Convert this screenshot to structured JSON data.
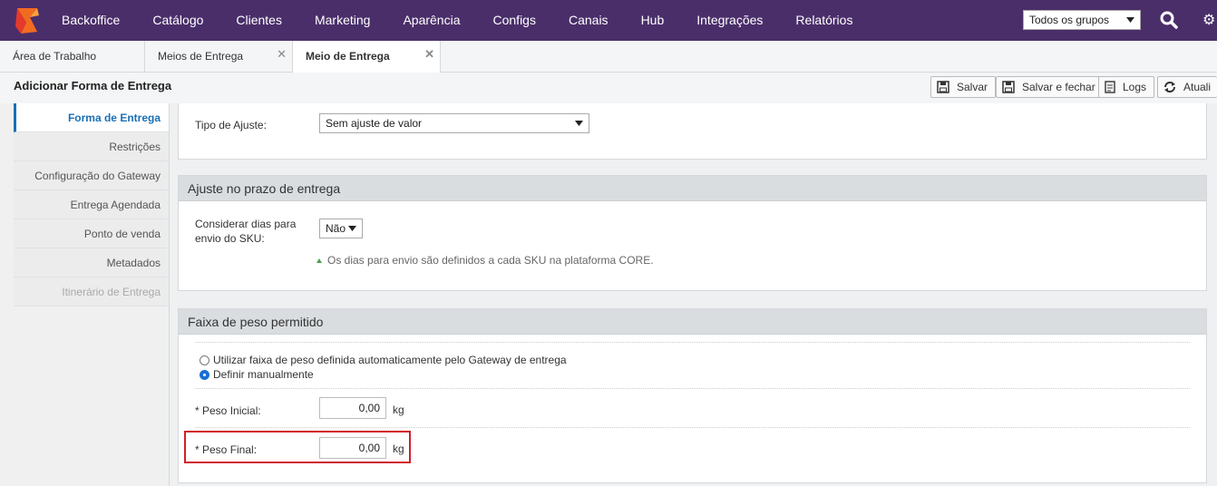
{
  "nav": {
    "items": [
      "Backoffice",
      "Catálogo",
      "Clientes",
      "Marketing",
      "Aparência",
      "Configs",
      "Canais",
      "Hub",
      "Integrações",
      "Relatórios"
    ],
    "group_select": "Todos os grupos"
  },
  "tabs": [
    {
      "label": "Área de Trabalho"
    },
    {
      "label": "Meios de Entrega",
      "close": "✕"
    },
    {
      "label": "Meio de Entrega",
      "close": "✕"
    }
  ],
  "title": "Adicionar Forma de Entrega",
  "toolbar": {
    "save": "Salvar",
    "save_close": "Salvar e fechar",
    "logs": "Logs",
    "refresh": "Atuali"
  },
  "left_menu": [
    "Forma de Entrega",
    "Restrições",
    "Configuração do Gateway",
    "Entrega Agendada",
    "Ponto de venda",
    "Metadados",
    "Itinerário de Entrega"
  ],
  "adjust": {
    "label": "Tipo de Ajuste:",
    "value": "Sem ajuste de valor"
  },
  "prazo": {
    "header": "Ajuste no prazo de entrega",
    "label_line1": "Considerar dias para",
    "label_line2": "envio do SKU:",
    "value": "Não",
    "hint": "Os dias para envio são definidos a cada SKU na plataforma CORE."
  },
  "peso": {
    "header": "Faixa de peso permitido",
    "radio_auto": "Utilizar faixa de peso definida automaticamente pelo Gateway de entrega",
    "radio_manual": "Definir manualmente",
    "inicial_label": "* Peso Inicial:",
    "inicial_value": "0,00",
    "final_label": "* Peso Final:",
    "final_value": "0,00",
    "unit": "kg"
  },
  "colors": {
    "topbar": "#4a2e6a",
    "accent": "#1a6fb5",
    "highlight": "#d0202a"
  }
}
